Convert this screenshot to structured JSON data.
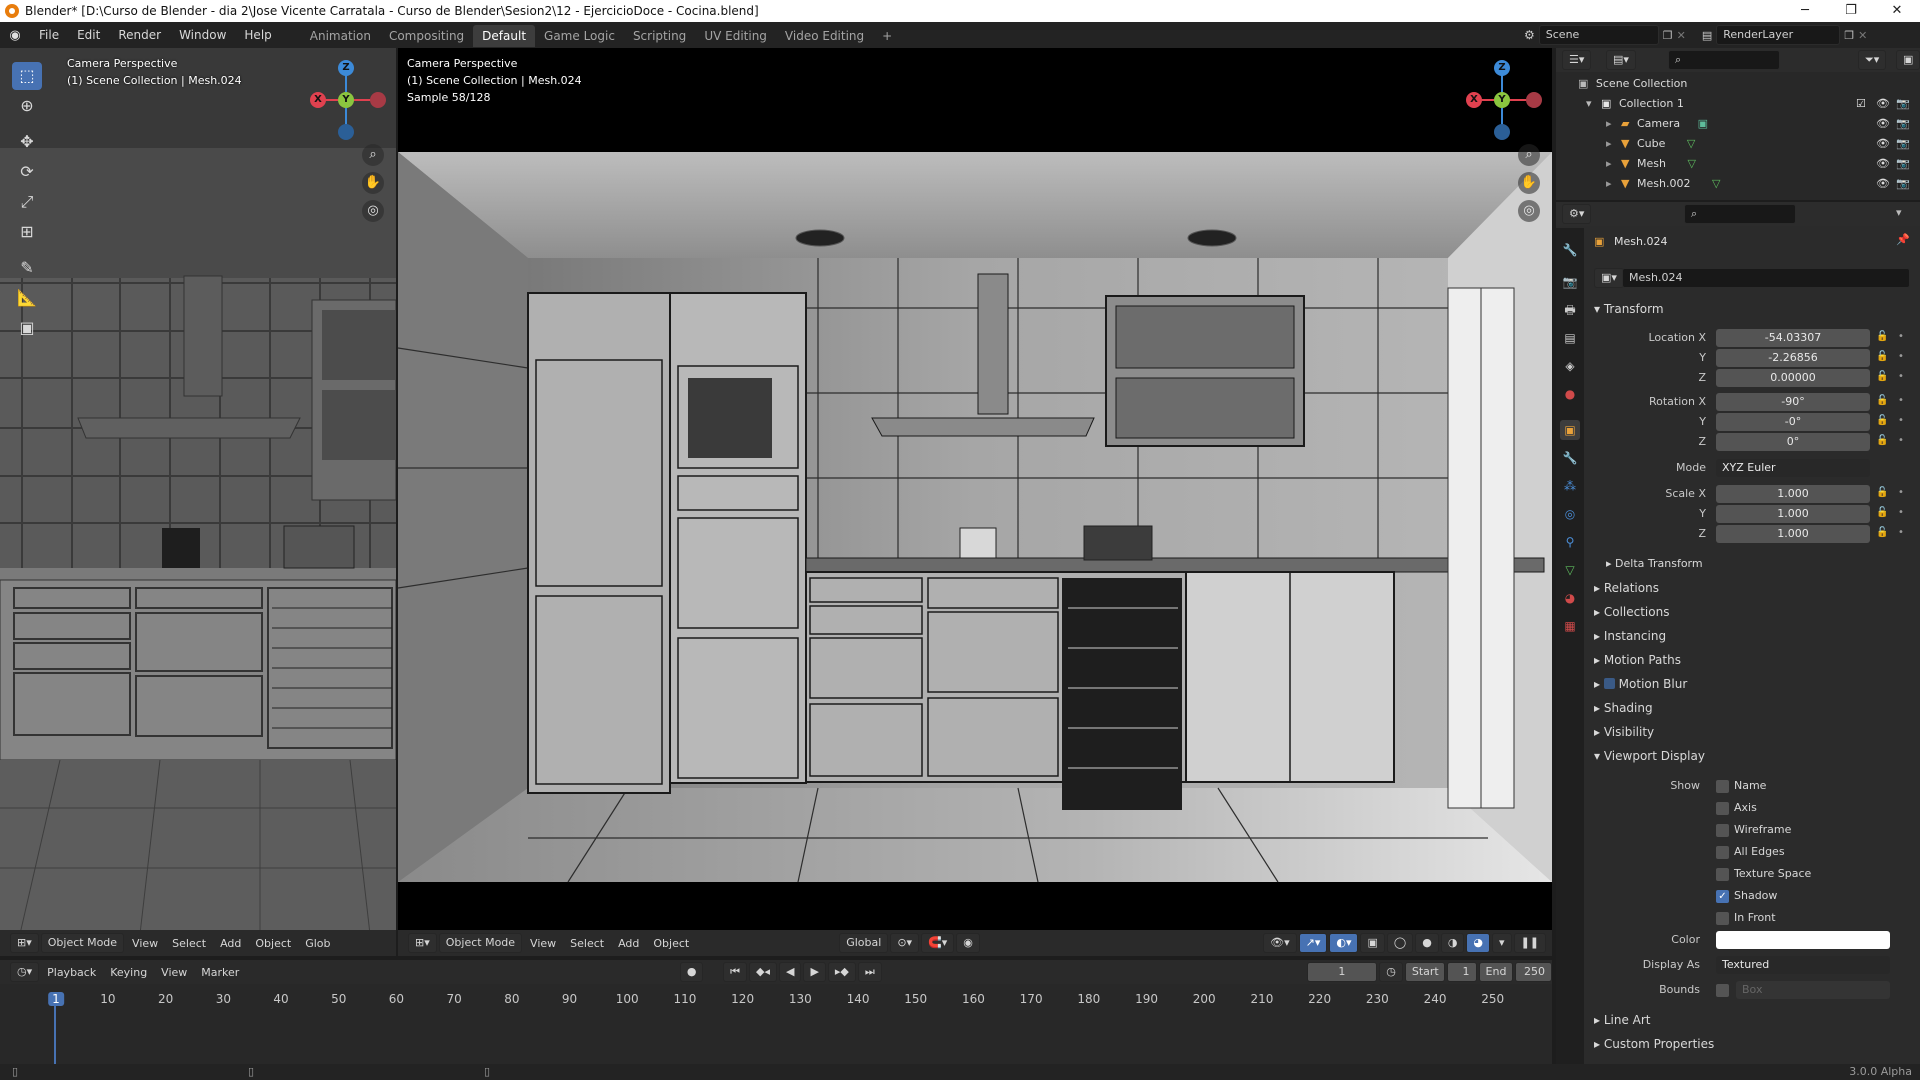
{
  "window": {
    "title": "Blender* [D:\\Curso de Blender - dia 2\\Jose Vicente Carratala - Curso de Blender\\Sesion2\\12 - EjercicioDoce - Cocina.blend]",
    "minimize": "─",
    "maximize": "❐",
    "close": "✕"
  },
  "menus": [
    "File",
    "Edit",
    "Render",
    "Window",
    "Help"
  ],
  "workspaces": [
    "Animation",
    "Compositing",
    "Default",
    "Game Logic",
    "Scripting",
    "UV Editing",
    "Video Editing",
    "+"
  ],
  "active_workspace": "Default",
  "scene_selector": {
    "scene": "Scene",
    "view_layer": "RenderLayer"
  },
  "viewport_left": {
    "line1": "Camera Perspective",
    "line2": "(1) Scene Collection | Mesh.024",
    "header": {
      "mode": "Object Mode",
      "menus": [
        "View",
        "Select",
        "Add",
        "Object"
      ],
      "orientation": "Glob"
    }
  },
  "viewport_main": {
    "line1": "Camera Perspective",
    "line2": "(1) Scene Collection | Mesh.024",
    "line3": "Sample 58/128",
    "header": {
      "mode": "Object Mode",
      "menus": [
        "View",
        "Select",
        "Add",
        "Object"
      ],
      "orientation": "Global"
    }
  },
  "gizmo": {
    "x": "X",
    "y": "Y",
    "z": "Z"
  },
  "timeline": {
    "menus": [
      "Playback",
      "Keying",
      "View",
      "Marker"
    ],
    "current_frame": "1",
    "start_label": "Start",
    "start": "1",
    "end_label": "End",
    "end": "250",
    "ticks": [
      "1",
      "10",
      "20",
      "30",
      "40",
      "50",
      "60",
      "70",
      "80",
      "90",
      "100",
      "110",
      "120",
      "130",
      "140",
      "150",
      "160",
      "170",
      "180",
      "190",
      "200",
      "210",
      "220",
      "230",
      "240",
      "250"
    ]
  },
  "outliner": {
    "root": "Scene Collection",
    "collection": "Collection 1",
    "items": [
      "Camera",
      "Cube",
      "Mesh",
      "Mesh.002"
    ]
  },
  "properties": {
    "object_name": "Mesh.024",
    "data_name": "Mesh.024",
    "transform_title": "Transform",
    "location": {
      "label": "Location X",
      "x": "-54.03307",
      "y": "-2.26856",
      "z": "0.00000"
    },
    "rotation": {
      "label": "Rotation X",
      "x": "-90°",
      "y": "-0°",
      "z": "0°"
    },
    "mode_label": "Mode",
    "mode": "XYZ Euler",
    "scale": {
      "label": "Scale X",
      "x": "1.000",
      "y": "1.000",
      "z": "1.000"
    },
    "axis_y": "Y",
    "axis_z": "Z",
    "delta_transform": "Delta Transform",
    "sections": [
      "Relations",
      "Collections",
      "Instancing",
      "Motion Paths",
      "Motion Blur",
      "Shading",
      "Visibility"
    ],
    "viewport_display": "Viewport Display",
    "show_label": "Show",
    "show_items": [
      {
        "label": "Name",
        "checked": false
      },
      {
        "label": "Axis",
        "checked": false
      },
      {
        "label": "Wireframe",
        "checked": false
      },
      {
        "label": "All Edges",
        "checked": false
      },
      {
        "label": "Texture Space",
        "checked": false
      },
      {
        "label": "Shadow",
        "checked": true
      },
      {
        "label": "In Front",
        "checked": false
      }
    ],
    "color_label": "Color",
    "display_as_label": "Display As",
    "display_as": "Textured",
    "bounds_label": "Bounds",
    "bounds": "Box",
    "line_art": "Line Art",
    "custom_properties": "Custom Properties"
  },
  "status": {
    "version": "3.0.0 Alpha"
  },
  "colors": {
    "accent": "#4772b3",
    "axis_x": "#e0414f",
    "axis_y": "#8bc53f",
    "axis_z": "#3c8ad8"
  }
}
